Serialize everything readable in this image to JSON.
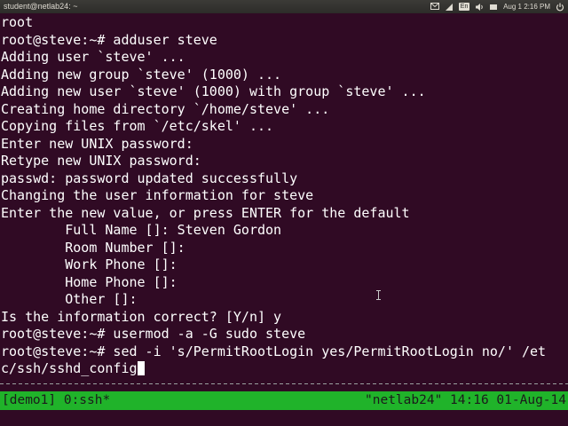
{
  "panel": {
    "window_title": "student@netlab24: ~",
    "keyboard_layout": "En",
    "clock": "Aug 1  2:16 PM",
    "icons": [
      "mail-icon",
      "network-icon",
      "keyboard-icon",
      "volume-icon",
      "power-icon"
    ]
  },
  "terminal": {
    "lines": [
      "root",
      "root@steve:~# adduser steve",
      "Adding user `steve' ...",
      "Adding new group `steve' (1000) ...",
      "Adding new user `steve' (1000) with group `steve' ...",
      "Creating home directory `/home/steve' ...",
      "Copying files from `/etc/skel' ...",
      "Enter new UNIX password:",
      "Retype new UNIX password:",
      "passwd: password updated successfully",
      "Changing the user information for steve",
      "Enter the new value, or press ENTER for the default",
      "        Full Name []: Steven Gordon",
      "        Room Number []:",
      "        Work Phone []:",
      "        Home Phone []:",
      "        Other []:",
      "Is the information correct? [Y/n] y",
      "root@steve:~# usermod -a -G sudo steve",
      "root@steve:~# sed -i 's/PermitRootLogin yes/PermitRootLogin no/' /et",
      "c/ssh/sshd_config"
    ],
    "foreground": "#ffffff",
    "background": "#300a24"
  },
  "tmux": {
    "left": "[demo1] 0:ssh*",
    "right": "\"netlab24\" 14:16 01-Aug-14",
    "background": "#20b32a"
  }
}
